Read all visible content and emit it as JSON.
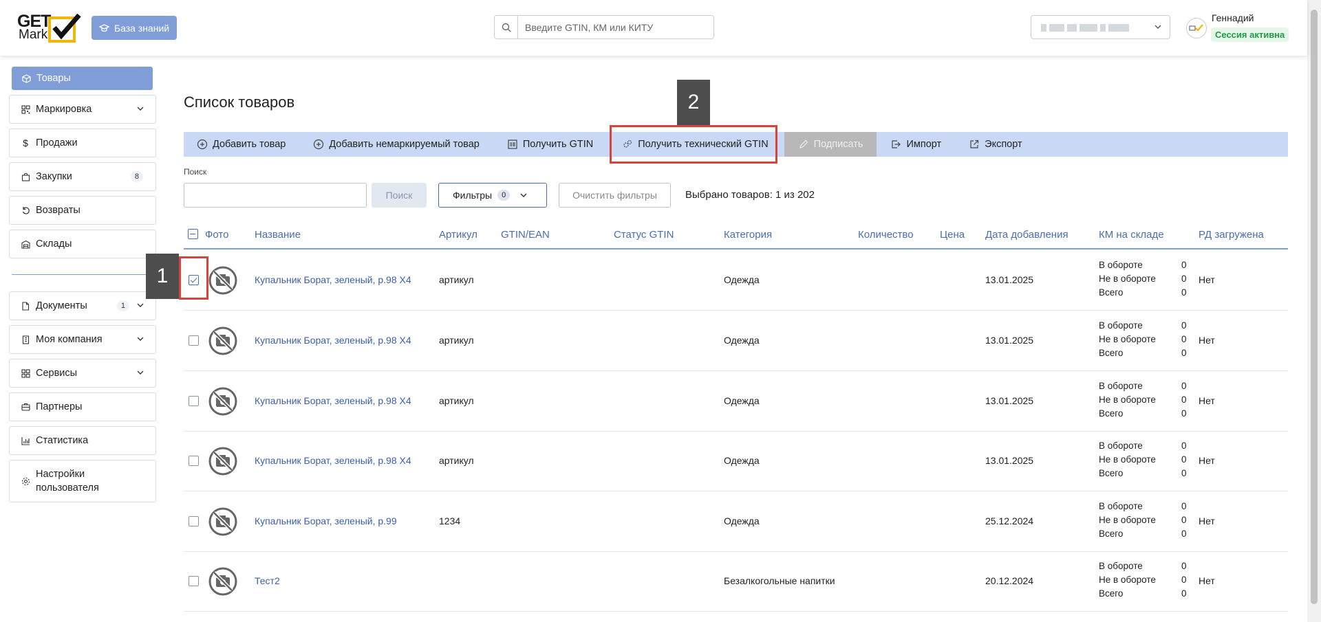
{
  "header": {
    "logo_top": "GET",
    "logo_bottom": "Mark",
    "kb_button": "База знаний",
    "search_placeholder": "Введите GTIN, КМ или КИТУ",
    "user_name": "Геннадий",
    "session_status": "Сессия активна"
  },
  "sidebar": {
    "items": [
      {
        "label": "Товары",
        "icon": "box-icon"
      },
      {
        "label": "Маркировка",
        "icon": "qr-icon"
      },
      {
        "label": "Продажи",
        "icon": "dollar-icon"
      },
      {
        "label": "Закупки",
        "icon": "bag-icon",
        "count": "8"
      },
      {
        "label": "Возвраты",
        "icon": "return-icon"
      },
      {
        "label": "Склады",
        "icon": "warehouse-icon"
      },
      {
        "label": "Документы",
        "icon": "document-icon",
        "count": "1"
      },
      {
        "label": "Моя компания",
        "icon": "building-icon"
      },
      {
        "label": "Сервисы",
        "icon": "grid-icon"
      },
      {
        "label": "Партнеры",
        "icon": "partners-icon"
      },
      {
        "label": "Статистика",
        "icon": "chart-icon"
      },
      {
        "label": "Настройки пользователя",
        "icon": "gear-icon"
      }
    ]
  },
  "main": {
    "title": "Список товаров",
    "toolbar": {
      "add_product": "Добавить товар",
      "add_unmarked": "Добавить немаркируемый товар",
      "get_gtin": "Получить GTIN",
      "get_tech_gtin": "Получить технический GTIN",
      "sign": "Подписать",
      "import": "Импорт",
      "export": "Экспорт"
    },
    "search_label": "Поиск",
    "search_button": "Поиск",
    "filters_label": "Фильтры",
    "filters_count": "0",
    "clear_filters": "Очистить фильтры",
    "selected_info": "Выбрано товаров: 1 из 202",
    "columns": [
      "Фото",
      "Название",
      "Артикул",
      "GTIN/EAN",
      "Статус GTIN",
      "Категория",
      "Количество",
      "Цена",
      "Дата добавления",
      "КМ на складе",
      "РД загружена"
    ],
    "km_labels": {
      "in": "В обороте",
      "out": "Не в обороте",
      "total": "Всего"
    },
    "rows": [
      {
        "name": "Купальник Борат, зеленый, р.98 Х4",
        "article": "артикул",
        "category": "Одежда",
        "date": "13.01.2025",
        "in": "0",
        "out": "0",
        "total": "0",
        "rd": "Нет",
        "checked": true
      },
      {
        "name": "Купальник Борат, зеленый, р.98 Х4",
        "article": "артикул",
        "category": "Одежда",
        "date": "13.01.2025",
        "in": "0",
        "out": "0",
        "total": "0",
        "rd": "Нет",
        "checked": false
      },
      {
        "name": "Купальник Борат, зеленый, р.98 Х4",
        "article": "артикул",
        "category": "Одежда",
        "date": "13.01.2025",
        "in": "0",
        "out": "0",
        "total": "0",
        "rd": "Нет",
        "checked": false
      },
      {
        "name": "Купальник Борат, зеленый, р.98 Х4",
        "article": "артикул",
        "category": "Одежда",
        "date": "13.01.2025",
        "in": "0",
        "out": "0",
        "total": "0",
        "rd": "Нет",
        "checked": false
      },
      {
        "name": "Купальник Борат, зеленый, р.99",
        "article": "1234",
        "category": "Одежда",
        "date": "25.12.2024",
        "in": "0",
        "out": "0",
        "total": "0",
        "rd": "Нет",
        "checked": false
      },
      {
        "name": "Тест2",
        "article": "",
        "category": "Безалкогольные напитки",
        "date": "20.12.2024",
        "in": "0",
        "out": "0",
        "total": "0",
        "rd": "Нет",
        "checked": false
      }
    ]
  },
  "annotations": {
    "tag1": "1",
    "tag2": "2",
    "color": "#d9433a"
  },
  "colors": {
    "accent": "#7f9ed8",
    "toolbar": "#c9d8f5",
    "link": "#3b5fa9",
    "session": "#1d9c44"
  }
}
